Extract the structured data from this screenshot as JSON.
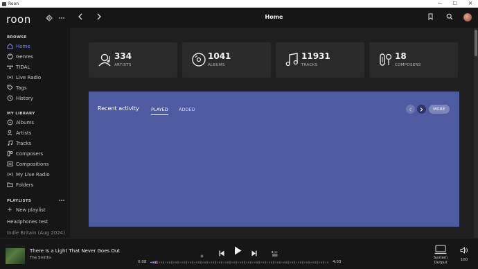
{
  "window": {
    "title": "Roon",
    "controls": [
      "—",
      "☐",
      "✕"
    ]
  },
  "sidebar": {
    "logo": "roon",
    "browse_title": "BROWSE",
    "browse": [
      {
        "label": "Home",
        "icon": "home-icon",
        "active": true
      },
      {
        "label": "Genres",
        "icon": "genres-icon"
      },
      {
        "label": "TIDAL",
        "icon": "tidal-icon"
      },
      {
        "label": "Live Radio",
        "icon": "radio-icon"
      },
      {
        "label": "Tags",
        "icon": "tag-icon"
      },
      {
        "label": "History",
        "icon": "history-icon"
      }
    ],
    "library_title": "MY LIBRARY",
    "library": [
      {
        "label": "Albums",
        "icon": "albums-icon"
      },
      {
        "label": "Artists",
        "icon": "artists-icon"
      },
      {
        "label": "Tracks",
        "icon": "tracks-icon"
      },
      {
        "label": "Composers",
        "icon": "composers-icon"
      },
      {
        "label": "Compositions",
        "icon": "compositions-icon"
      },
      {
        "label": "My Live Radio",
        "icon": "my-radio-icon"
      },
      {
        "label": "Folders",
        "icon": "folder-icon"
      }
    ],
    "playlists_title": "PLAYLISTS",
    "new_playlist": "New playlist",
    "playlists": [
      "Headphones test",
      "Indie Britain (Aug 2024)"
    ]
  },
  "header": {
    "title": "Home"
  },
  "stats": [
    {
      "value": "334",
      "label": "ARTISTS",
      "icon": "artists-icon"
    },
    {
      "value": "1041",
      "label": "ALBUMS",
      "icon": "albums-icon"
    },
    {
      "value": "11931",
      "label": "TRACKS",
      "icon": "tracks-icon"
    },
    {
      "value": "18",
      "label": "COMPOSERS",
      "icon": "composers-icon"
    }
  ],
  "activity": {
    "title": "Recent activity",
    "tabs": [
      "PLAYED",
      "ADDED"
    ],
    "active_tab": "PLAYED",
    "more_label": "MORE"
  },
  "player": {
    "track": "There Is a Light That Never Goes Out",
    "artist": "The Smiths",
    "elapsed": "0:08",
    "duration": "4:03",
    "progress": 0.033,
    "output_label": "System Output",
    "volume": "100"
  },
  "colors": {
    "accent": "#7e87f5",
    "activity_bg": "#4e5ba1",
    "sidebar_bg": "#161616",
    "main_bg": "#1f1f1f",
    "card_bg": "#2a2a2a"
  }
}
